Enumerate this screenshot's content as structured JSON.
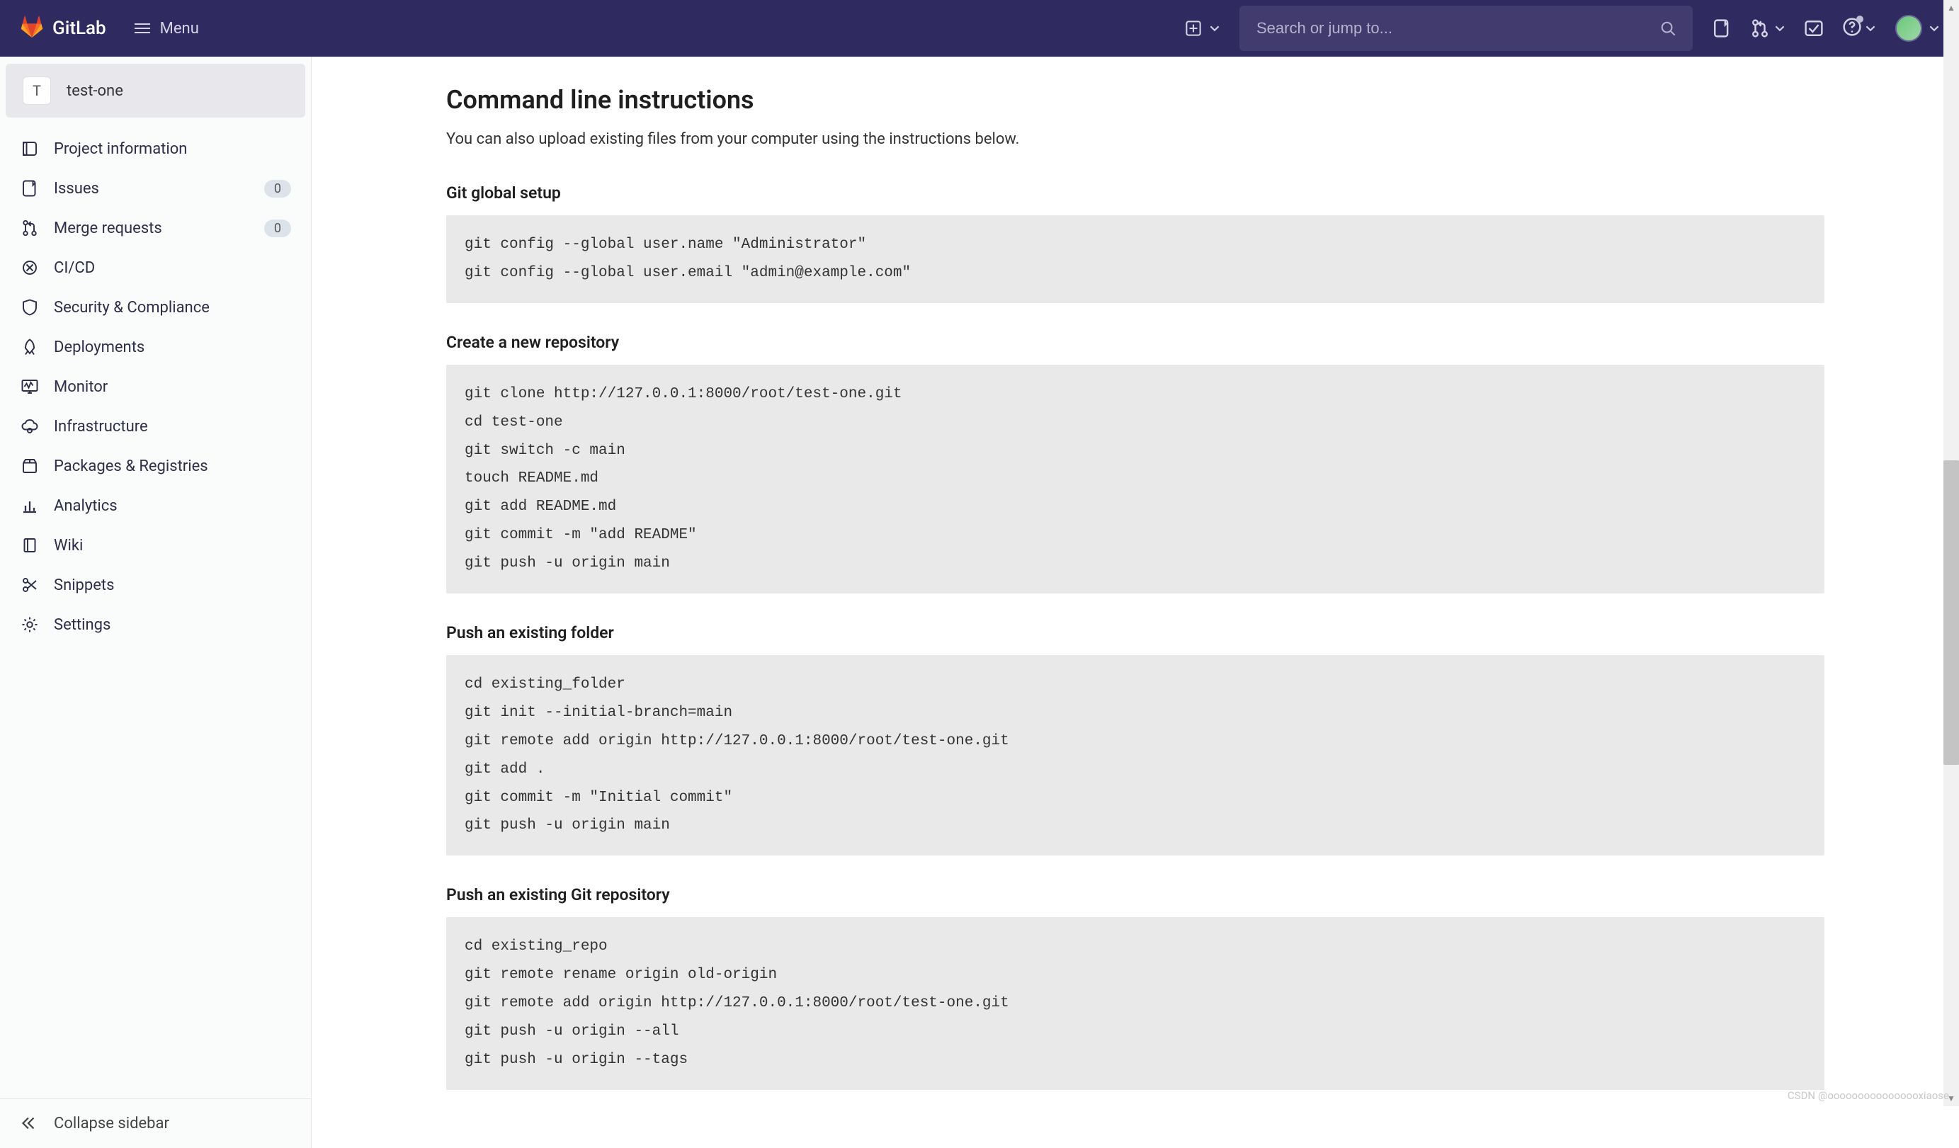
{
  "header": {
    "brand": "GitLab",
    "menu_label": "Menu",
    "search_placeholder": "Search or jump to..."
  },
  "project": {
    "avatar_letter": "T",
    "name": "test-one"
  },
  "sidebar": {
    "items": [
      {
        "label": "Project information"
      },
      {
        "label": "Issues",
        "badge": "0"
      },
      {
        "label": "Merge requests",
        "badge": "0"
      },
      {
        "label": "CI/CD"
      },
      {
        "label": "Security & Compliance"
      },
      {
        "label": "Deployments"
      },
      {
        "label": "Monitor"
      },
      {
        "label": "Infrastructure"
      },
      {
        "label": "Packages & Registries"
      },
      {
        "label": "Analytics"
      },
      {
        "label": "Wiki"
      },
      {
        "label": "Snippets"
      },
      {
        "label": "Settings"
      }
    ],
    "collapse_label": "Collapse sidebar"
  },
  "page": {
    "title": "Command line instructions",
    "subtitle": "You can also upload existing files from your computer using the instructions below.",
    "sections": [
      {
        "heading": "Git global setup",
        "code": "git config --global user.name \"Administrator\"\ngit config --global user.email \"admin@example.com\""
      },
      {
        "heading": "Create a new repository",
        "code": "git clone http://127.0.0.1:8000/root/test-one.git\ncd test-one\ngit switch -c main\ntouch README.md\ngit add README.md\ngit commit -m \"add README\"\ngit push -u origin main"
      },
      {
        "heading": "Push an existing folder",
        "code": "cd existing_folder\ngit init --initial-branch=main\ngit remote add origin http://127.0.0.1:8000/root/test-one.git\ngit add .\ngit commit -m \"Initial commit\"\ngit push -u origin main"
      },
      {
        "heading": "Push an existing Git repository",
        "code": "cd existing_repo\ngit remote rename origin old-origin\ngit remote add origin http://127.0.0.1:8000/root/test-one.git\ngit push -u origin --all\ngit push -u origin --tags"
      }
    ]
  },
  "watermark": "CSDN @oooooooooooooooxiaose"
}
